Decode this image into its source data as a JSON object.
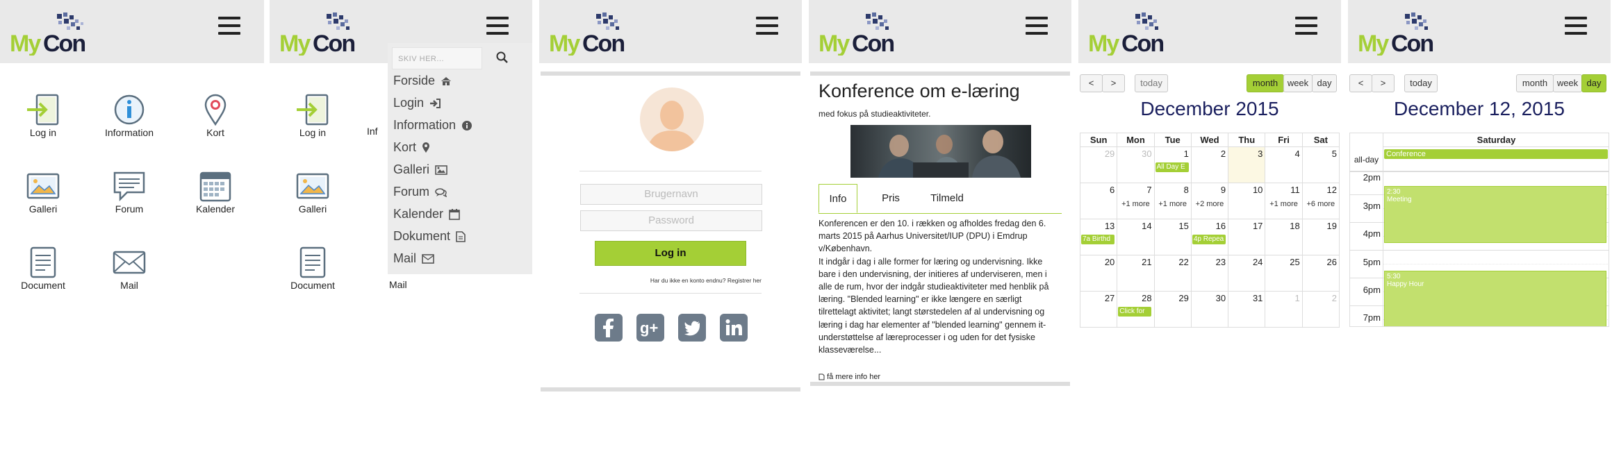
{
  "brand": {
    "logo_text_my": "My",
    "logo_text_con": "Con",
    "accent": "#a4cf36",
    "dark": "#1a1f5e"
  },
  "home": {
    "tiles": [
      {
        "label": "Log in",
        "icon": "login-icon"
      },
      {
        "label": "Information",
        "icon": "info-icon"
      },
      {
        "label": "Kort",
        "icon": "map-pin-icon"
      },
      {
        "label": "Galleri",
        "icon": "gallery-icon"
      },
      {
        "label": "Forum",
        "icon": "forum-icon"
      },
      {
        "label": "Kalender",
        "icon": "calendar-icon"
      },
      {
        "label": "Document",
        "icon": "document-icon"
      },
      {
        "label": "Mail",
        "icon": "mail-icon"
      }
    ]
  },
  "menu_screen": {
    "peek": {
      "login": "Log in",
      "info": "Inf",
      "galleri": "Galleri",
      "document": "Document",
      "mail": "Mail"
    },
    "search_placeholder": "SKIV HER...",
    "items": [
      {
        "label": "Forside",
        "icon": "home-icon"
      },
      {
        "label": "Login",
        "icon": "sign-in-icon"
      },
      {
        "label": "Information",
        "icon": "info-circle-icon"
      },
      {
        "label": "Kort",
        "icon": "map-marker-icon"
      },
      {
        "label": "Galleri",
        "icon": "image-icon"
      },
      {
        "label": "Forum",
        "icon": "comments-icon"
      },
      {
        "label": "Kalender",
        "icon": "calendar-icon"
      },
      {
        "label": "Dokument",
        "icon": "file-icon"
      },
      {
        "label": "Mail",
        "icon": "envelope-icon"
      }
    ]
  },
  "login": {
    "username_placeholder": "Brugernavn",
    "password_placeholder": "Password",
    "button": "Log in",
    "register_text": "Har du ikke en konto endnu? Registrer her",
    "social": [
      "facebook-icon",
      "google-plus-icon",
      "twitter-icon",
      "linkedin-icon"
    ]
  },
  "conference": {
    "title": "Konference om e-læring",
    "subtitle": "med fokus på studieaktiviteter.",
    "tabs": [
      "Info",
      "Pris",
      "Tilmeld"
    ],
    "body_lines": [
      "Konferencen er den 10. i rækken og afholdes fredag den 6.",
      "marts 2015 på Aarhus Universitet/IUP (DPU) i Emdrup",
      "v/København.",
      "It indgår i dag i alle former for læring og undervisning. Ikke",
      "bare i den undervisning, der initieres af underviseren, men i",
      "alle de rum, hvor der indgår studieaktiviteter med henblik på",
      "læring. \"Blended learning\" er ikke længere en særligt",
      "tilrettelagt aktivitet; langt størstedelen af al undervisning og",
      "læring i dag har elementer af \"blended learning\" gennem it-",
      "understøttelse af læreprocesser i og uden for det fysiske",
      "klasseværelse..."
    ],
    "more_link": "få mere info her"
  },
  "calendar_month": {
    "prev": "<",
    "next": ">",
    "today": "today",
    "views": [
      "month",
      "week",
      "day"
    ],
    "active_view": "month",
    "title": "December 2015",
    "weekdays": [
      "Sun",
      "Mon",
      "Tue",
      "Wed",
      "Thu",
      "Fri",
      "Sat"
    ],
    "weeks": [
      [
        {
          "d": "29",
          "o": true
        },
        {
          "d": "30",
          "o": true
        },
        {
          "d": "1",
          "ev": "All Day E"
        },
        {
          "d": "2"
        },
        {
          "d": "3",
          "t": true
        },
        {
          "d": "4"
        },
        {
          "d": "5"
        }
      ],
      [
        {
          "d": "6"
        },
        {
          "d": "7",
          "more": "+1 more"
        },
        {
          "d": "8",
          "more": "+1 more"
        },
        {
          "d": "9",
          "more": "+2 more"
        },
        {
          "d": "10"
        },
        {
          "d": "11",
          "more": "+1 more"
        },
        {
          "d": "12",
          "more": "+6 more"
        }
      ],
      [
        {
          "d": "13",
          "ev": "7a Birthd"
        },
        {
          "d": "14"
        },
        {
          "d": "15"
        },
        {
          "d": "16",
          "ev": "4p Repea"
        },
        {
          "d": "17"
        },
        {
          "d": "18"
        },
        {
          "d": "19"
        }
      ],
      [
        {
          "d": "20"
        },
        {
          "d": "21"
        },
        {
          "d": "22"
        },
        {
          "d": "23"
        },
        {
          "d": "24"
        },
        {
          "d": "25"
        },
        {
          "d": "26"
        }
      ],
      [
        {
          "d": "27"
        },
        {
          "d": "28",
          "ev": "Click for"
        },
        {
          "d": "29"
        },
        {
          "d": "30"
        },
        {
          "d": "31"
        },
        {
          "d": "1",
          "o": true
        },
        {
          "d": "2",
          "o": true
        }
      ]
    ]
  },
  "calendar_day": {
    "prev": "<",
    "next": ">",
    "today": "today",
    "views": [
      "month",
      "week",
      "day"
    ],
    "active_view": "day",
    "title": "December 12, 2015",
    "day_header": "Saturday",
    "allday_label": "all-day",
    "allday_event": "Conference",
    "hours": [
      "2pm",
      "3pm",
      "4pm",
      "5pm",
      "6pm",
      "7pm"
    ],
    "events": [
      {
        "time": "2:30",
        "title": "Meeting"
      },
      {
        "time": "5:30",
        "title": "Happy Hour"
      }
    ]
  }
}
